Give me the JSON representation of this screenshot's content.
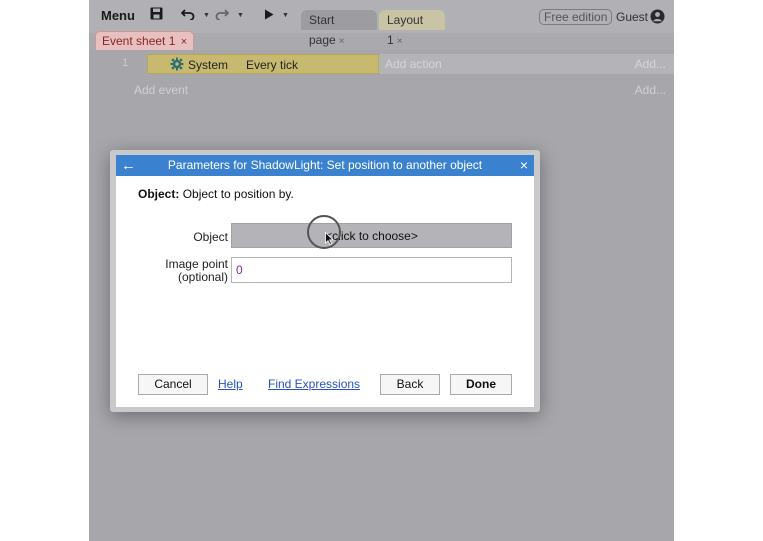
{
  "toolbar": {
    "menu_label": "Menu",
    "save_icon": "save-icon",
    "undo_icon": "undo-icon",
    "redo_icon": "redo-icon",
    "play_icon": "play-icon",
    "tabs": [
      {
        "label": "Start page",
        "close": "×"
      },
      {
        "label": "Layout 1",
        "close": "×"
      }
    ],
    "edition_badge": "Free edition",
    "user_label": "Guest"
  },
  "sheet": {
    "tab_label": "Event sheet 1",
    "tab_close": "×",
    "events": [
      {
        "number": "1",
        "object": "System",
        "condition": "Every tick",
        "add_action": "Add action",
        "add_more": "Add..."
      }
    ],
    "add_event": "Add event",
    "add_event_more": "Add..."
  },
  "dialog": {
    "back_icon": "←",
    "title": "Parameters for ShadowLight: Set position to another object",
    "close_icon": "×",
    "description_label": "Object:",
    "description_text": "Object to position by.",
    "object_label": "Object",
    "object_button": "<click to choose>",
    "image_point_label_1": "Image point",
    "image_point_label_2": "(optional)",
    "image_point_value": "0",
    "buttons": {
      "cancel": "Cancel",
      "help": "Help",
      "find_expressions": "Find Expressions",
      "back": "Back",
      "done": "Done"
    }
  },
  "colors": {
    "title_bar": "#3a81cf",
    "condition_bg": "#c7ba70",
    "link": "#2851c8",
    "value_text": "#8a2aa8"
  }
}
